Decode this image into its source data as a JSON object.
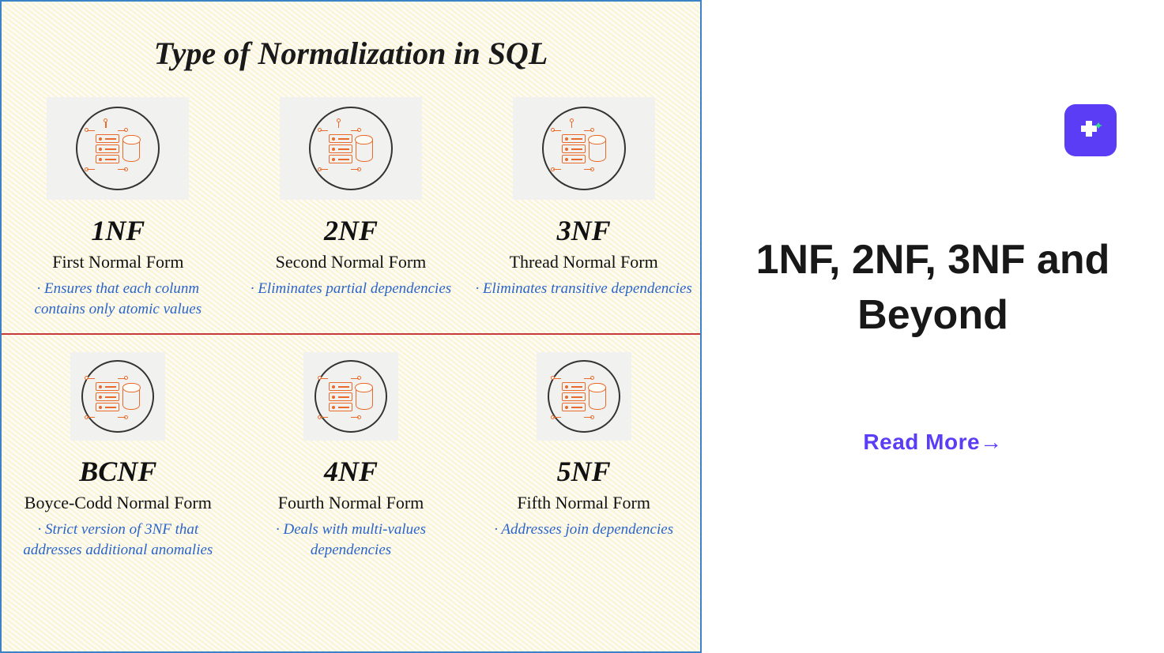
{
  "diagram": {
    "title": "Type of Normalization in SQL",
    "forms": [
      {
        "abbr": "1NF",
        "full": "First Normal Form",
        "desc": "· Ensures that each colunm contains only atomic values",
        "icon": "db-schema-icon"
      },
      {
        "abbr": "2NF",
        "full": "Second Normal Form",
        "desc": "· Eliminates partial dependencies",
        "icon": "db-schema-icon"
      },
      {
        "abbr": "3NF",
        "full": "Thread Normal Form",
        "desc": "· Eliminates transitive dependencies",
        "icon": "db-schema-icon"
      },
      {
        "abbr": "BCNF",
        "full": "Boyce-Codd Normal Form",
        "desc": "· Strict version of 3NF that addresses additional anomalies",
        "icon": "db-schema-icon"
      },
      {
        "abbr": "4NF",
        "full": "Fourth Normal Form",
        "desc": "· Deals with multi-values dependencies",
        "icon": "db-schema-icon"
      },
      {
        "abbr": "5NF",
        "full": "Fifth Normal Form",
        "desc": "· Addresses join dependencies",
        "icon": "db-schema-icon"
      }
    ]
  },
  "right": {
    "heading": "1NF, 2NF, 3NF and Beyond",
    "cta": "Read More→",
    "logo_icon": "app-logo-icon"
  },
  "colors": {
    "accent_blue": "#2b64c9",
    "accent_purple": "#5b3df5",
    "icon_orange": "#ea6a2b",
    "border_blue": "#3b82c7",
    "divider_red": "#c73a3a"
  }
}
